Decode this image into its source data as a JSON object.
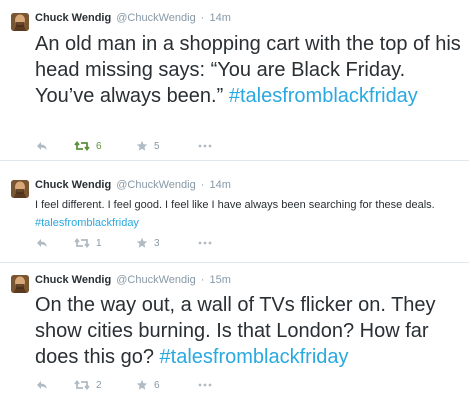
{
  "tweets": [
    {
      "author": "Chuck Wendig",
      "handle": "@ChuckWendig",
      "separator": "·",
      "time": "14m",
      "text": "An old man in a shopping cart with the top of his head missing says: “You are Black Friday. You’ve always been.”",
      "hashtag": "#talesfromblackfriday",
      "retweets": "6",
      "favorites": "5",
      "retweeted": true
    },
    {
      "author": "Chuck Wendig",
      "handle": "@ChuckWendig",
      "separator": "·",
      "time": "14m",
      "text": "I feel different. I feel good. I feel like I have always been searching for these deals.",
      "hashtag": "#talesfromblackfriday",
      "retweets": "1",
      "favorites": "3",
      "retweeted": false
    },
    {
      "author": "Chuck Wendig",
      "handle": "@ChuckWendig",
      "separator": "·",
      "time": "15m",
      "text": "On the way out, a wall of TVs flicker on. They show cities burning. Is that London? How far does this go?",
      "hashtag": "#talesfromblackfriday",
      "retweets": "2",
      "favorites": "6",
      "retweeted": false
    }
  ],
  "colors": {
    "hashtag": "#2aa9e0",
    "retweet_active": "#5c913b",
    "muted": "#8899a6",
    "text": "#292f33"
  },
  "icons": [
    "avatar",
    "reply-icon",
    "retweet-icon",
    "favorite-icon",
    "more-icon"
  ]
}
